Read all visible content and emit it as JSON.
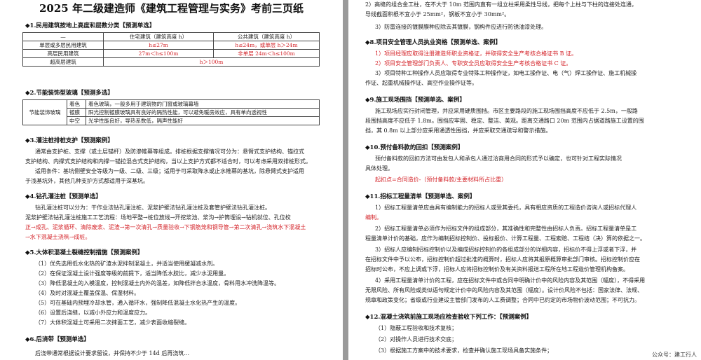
{
  "left": {
    "title": "2025 年二级建造师《建筑工程管理与实务》考前三页纸",
    "s1": {
      "heading": "◆1.民用建筑按地上高度和层数分类【预测单选】",
      "table": {
        "head": [
          "—",
          "住宅建筑（建筑高度 h）",
          "公共建筑（建筑高度 h）"
        ],
        "rows": [
          [
            "单层或多层民用建筑",
            "h≤27m",
            "h≤24m，或单层 h＞24m"
          ],
          [
            "高层民用建筑",
            "27m＜h≤100m",
            "非单层 24m＜h≤100m"
          ],
          [
            "超高层建筑",
            "h＞100m"
          ]
        ]
      }
    },
    "s2": {
      "heading": "◆2.节能装饰型玻璃【预测多选】",
      "category": "节能装饰玻璃",
      "rows": [
        [
          "着色",
          "着色玻璃，一般多用于建筑物的门窗或玻璃幕墙"
        ],
        [
          "镀膜",
          "阳光控制镀膜玻璃具有良好的隔热性能，可以避免暖房效应，具有单向透视性"
        ],
        [
          "中空",
          "光学性能良好，导热系数低，隔声性能好"
        ]
      ]
    },
    "s3": {
      "heading": "◆3.灌注桩排桩支护【预测案例】",
      "lines": [
        "通常由支护桩、支撑（或土层锚杆）及防渗帷幕等组成。排桩根据支撑情况可分为：悬臂式支护结构、锚拉式",
        "支护结构、内撑式支护结构和内撑一锚拉混合式支护结构，当以上支护方式都不适合时，可以考虑采用双排桩形式。",
        "适用条件：基坑侧壁安全等级为一级、二级、三级；适用于可采取降水或止水帷幕的基坑，除悬臂式支护适用",
        "于浅基坑外，其他几种支护方式都适用于深基坑。"
      ]
    },
    "s4": {
      "heading": "◆4.钻孔灌注桩【预测单选】",
      "lines": [
        "钻孔灌注桩可以分为：干作业法钻孔灌注桩、泥浆护壁法钻孔灌注桩及套管护壁法钻孔灌注桩。",
        "泥浆护壁法钻孔灌注桩施工工艺流程：场地平整→桩位放线→开挖浆池、浆沟→护筒埋设→钻机就位、孔位校",
        "正→成孔、泥浆循环、清除废浆、泥渣→第一次清孔→质量验收→下钢筋笼和钢导管→第二次清孔→浇筑水下混凝土",
        "→水下混凝土浇筑→成桩。"
      ]
    },
    "s5": {
      "heading": "◆5.大体积混凝土裂缝控制措施【预测案例】",
      "items": [
        "（1）优先选用低水化热的矿渣水泥拌制混凝土，并适当使用缓凝减水剂。",
        "（2）在保证混凝土设计强度等级的前提下，适当降低水胶比，减少水泥用量。",
        "（3）降低混凝土的入模温度，控制混凝土内外的温差，如降低拌合水温度，骨料用水冲洗降温等。",
        "（4）及时对混凝土覆盖保温、保湿材料。",
        "（5）可在基础内预埋冷却水管，通入循环水，强制降低混凝土水化热产生的温度。",
        "（6）设置后浇缝，以减小外应力和温度应力。",
        "（7）大体积混凝土可采用二次抹面工艺，减少表面收缩裂缝。"
      ]
    },
    "s6": {
      "heading": "◆6.后浇带【预测单选】",
      "partial": "后浇带通常根据设计要求留设，并保持不少于 14d 后再浇筑..."
    }
  },
  "right": {
    "top_lines": [
      "2）高缝的组合金工柱，在不大于 10m 范围内直有一组立柱采用柔性导线，把每个上柱与下柱的连接处连通，",
      "导线截面积根不宜小于 25mm²，钢板不宜小于 30mm²。",
      "3）防雷连接的镀膜膜种应除去其镀膜，钢构件应进行防锈油漆处理。"
    ],
    "s8": {
      "heading": "◆8.项目安全管理人员执业资格【预测单选、案例】",
      "items": [
        "1）项目经理应取得注册建造师职业资格证，并取得安全生产考核合格证书 B 证。",
        "2）项目安全管理部门负责人、专职安全员应取得安全生产考核合格证书 C 证。",
        "3）项目特种工种操作人员应取得专业特殊工种操作证，如电工操作证、电（气）焊工操作证、施工机械操",
        "作证、起重机械操作证、高空作业操作证等。"
      ]
    },
    "s9": {
      "heading": "◆9.施工现场围挡【预测单选、案例】",
      "lines": [
        "施工现场应实行封闭管理，并应采用硬质围挡。市区主要路段的施工现场围挡高度不应低于 2.5m，一般路",
        "段围挡高度不应低于 1.8m。围挡应牢固、稳定、整洁、美观。距离交通路口 20m 范围内占据道路施工设置的围",
        "挡，其 0.8m 以上部分应采用通透性围挡，并应采取交通疏导和警示措施。"
      ]
    },
    "s10": {
      "heading": "◆10.预付备料款的回扣【预测案例】",
      "lines": [
        "预付备料款的回扣方法可由发包人和承包人通过洽商用合同的形式予以确定，也可针对工程实际情况",
        "具体处理。",
        "起扣点=合同造价-（预付备料款/主要材料所占比重）"
      ]
    },
    "s11": {
      "heading": "◆11.招标工程量清单【预测单选、案例】",
      "lines": [
        "1）招标工程量清单应由具有编制能力的招标人或受其委托，具有相应资质的工程造价咨询人或招标代理人",
        "编制。",
        "2）招标工程量清单必须作为招标文件的组成部分，其准确性和完整性由招标人负责。招标工程量清单是工",
        "程量清单计价的基础，应作为编制招标控制价、投标报价、计算工程量、工程索赔、工程结（决）算的依据之一。",
        "3）招标人应编制招标控制价以及编成招标控制价的各组成部分的详细内容，招标价不得上浮或者下浮，并",
        "在招标文件中予以公布，招标控制价超过批准的概算时，招标人应将其报原概算审批部门审核。招标控制价应在",
        "招标时公布，不应上调或下浮，招标人应将招标控制价及有关资料报送工程所在地工程造价管理机构备案。",
        "4）采用工程量清单计价的工程，应在招标文件中或合同中明确计价中的风险内容及其范围（幅度），不得采用",
        "无限风险、所有风险或类似语句规定计价中的风险内容及其范围（幅度）。设计价风险不包括：国家法律、法规、",
        "规章和政策变化；省级或行业建设主管部门发布的人工费调整；合同中已约定的市场物价波动范围；不可抗力。"
      ]
    },
    "s12": {
      "heading": "◆12.混凝土浇筑前施工现场应检查验收下列工作：【预测案例】",
      "items": [
        "（1）隐蔽工程验收和技术复核；",
        "（2）对操作人员进行技术交底；",
        "（3）根据施工方案中的技术要求，检查并确认施工现场具备实施条件；"
      ]
    },
    "watermark": "公众号：建工行人"
  }
}
